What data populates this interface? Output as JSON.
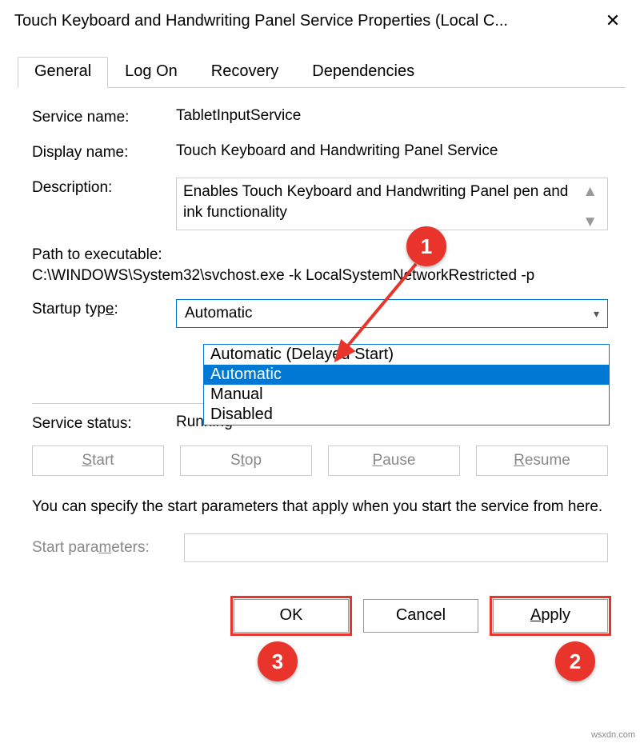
{
  "window": {
    "title": "Touch Keyboard and Handwriting Panel Service Properties (Local C..."
  },
  "tabs": {
    "general": "General",
    "logon": "Log On",
    "recovery": "Recovery",
    "dependencies": "Dependencies"
  },
  "fields": {
    "service_name_label": "Service name:",
    "service_name_value": "TabletInputService",
    "display_name_label": "Display name:",
    "display_name_value": "Touch Keyboard and Handwriting Panel Service",
    "description_label": "Description:",
    "description_value": "Enables Touch Keyboard and Handwriting Panel pen and ink functionality",
    "path_label": "Path to executable:",
    "path_value": "C:\\WINDOWS\\System32\\svchost.exe -k LocalSystemNetworkRestricted -p",
    "startup_type_label": "Startup type:",
    "startup_type_value": "Automatic",
    "service_status_label": "Service status:",
    "service_status_value": "Running",
    "help_text": "You can specify the start parameters that apply when you start the service from here.",
    "start_parameters_label": "Start parameters:",
    "start_parameters_value": ""
  },
  "dropdown_options": {
    "opt0": "Automatic (Delayed Start)",
    "opt1": "Automatic",
    "opt2": "Manual",
    "opt3": "Disabled"
  },
  "control_buttons": {
    "start": "Start",
    "stop": "Stop",
    "pause": "Pause",
    "resume": "Resume"
  },
  "dialog_buttons": {
    "ok": "OK",
    "cancel": "Cancel",
    "apply": "Apply"
  },
  "annotations": {
    "c1": "1",
    "c2": "2",
    "c3": "3"
  },
  "watermark": "wsxdn.com"
}
